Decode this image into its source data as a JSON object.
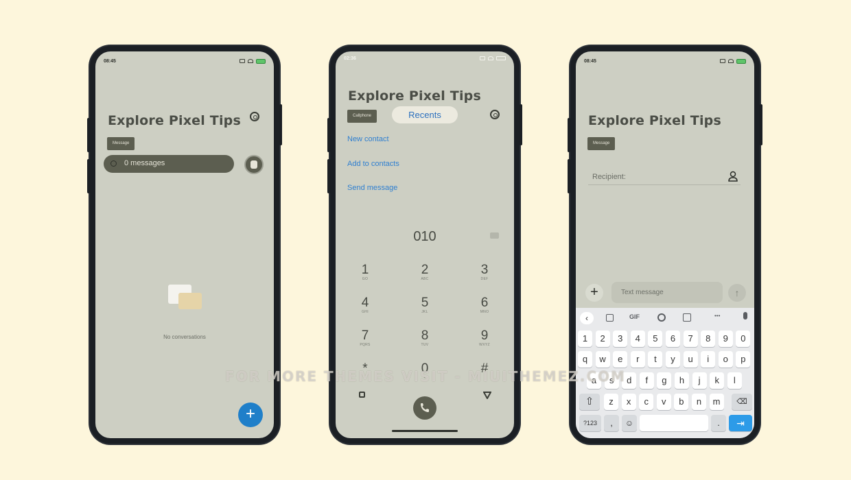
{
  "phone1": {
    "time": "08:45",
    "title": "Explore Pixel Tips",
    "chip": "Message",
    "search_placeholder": "0 messages",
    "empty_text": "No conversations",
    "fab": "+"
  },
  "phone2": {
    "time": "02:36",
    "title": "Explore Pixel Tips",
    "chip": "Callphone",
    "recents": "Recents",
    "links": [
      "New contact",
      "Add to contacts",
      "Send message"
    ],
    "dialed": "010",
    "keys": [
      {
        "d": "1",
        "l": "GO"
      },
      {
        "d": "2",
        "l": "ABC"
      },
      {
        "d": "3",
        "l": "DEF"
      },
      {
        "d": "4",
        "l": "GHI"
      },
      {
        "d": "5",
        "l": "JKL"
      },
      {
        "d": "6",
        "l": "MNO"
      },
      {
        "d": "7",
        "l": "PQRS"
      },
      {
        "d": "8",
        "l": "TUV"
      },
      {
        "d": "9",
        "l": "WXYZ"
      },
      {
        "d": "*",
        "l": ""
      },
      {
        "d": "0",
        "l": "+"
      },
      {
        "d": "#",
        "l": ""
      }
    ]
  },
  "phone3": {
    "time": "08:45",
    "title": "Explore Pixel Tips",
    "chip": "Message",
    "recipient_placeholder": "Recipient:",
    "text_placeholder": "Text message",
    "kb_toolbar_gif": "GIF",
    "kb_toolbar_more": "•••",
    "row_numbers": [
      "1",
      "2",
      "3",
      "4",
      "5",
      "6",
      "7",
      "8",
      "9",
      "0"
    ],
    "row_q": [
      "q",
      "w",
      "e",
      "r",
      "t",
      "y",
      "u",
      "i",
      "o",
      "p"
    ],
    "row_a": [
      "a",
      "s",
      "d",
      "f",
      "g",
      "h",
      "j",
      "k",
      "l"
    ],
    "row_z": [
      "z",
      "x",
      "c",
      "v",
      "b",
      "n",
      "m"
    ],
    "key_123": "?123",
    "key_comma": ",",
    "key_period": "."
  },
  "watermark": "FOR MORE THEMES VISIT - MIUITHEMEZ.COM",
  "colors": {
    "background": "#fdf6dc",
    "screen": "#cdcfc3",
    "chip": "#5c5e50",
    "link": "#2f7fd0",
    "fab": "#1f7fc9",
    "enter_key": "#2d9be8"
  }
}
